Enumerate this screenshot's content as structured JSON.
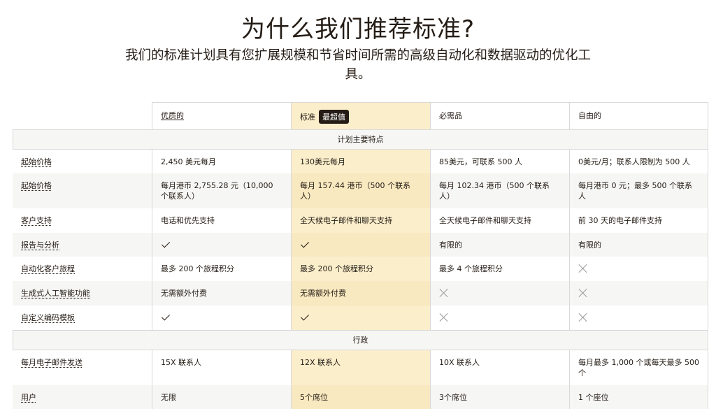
{
  "header": {
    "title": "为什么我们推荐标准?",
    "subtitle": "我们的标准计划具有您扩展规模和节省时间所需的高级自动化和数据驱动的优化工具。"
  },
  "plans": [
    {
      "name": "优质的",
      "badge": ""
    },
    {
      "name": "标准",
      "badge": "最超值"
    },
    {
      "name": "必需品",
      "badge": ""
    },
    {
      "name": "自由的",
      "badge": ""
    }
  ],
  "sections": {
    "features": "计划主要特点",
    "admin": "行政"
  },
  "rows": {
    "price_usd": {
      "label": "起始价格",
      "values": [
        "2,450 美元每月",
        "130美元每月",
        "85美元，可联系 500 人",
        "0美元/月；联系人限制为 500 人"
      ]
    },
    "price_hkd": {
      "label": "起始价格",
      "values": [
        "每月港币 2,755.28 元（10,000 个联系人）",
        "每月 157.44 港币（500 个联系人）",
        "每月 102.34 港币（500 个联系人）",
        "每月港币 0 元；最多 500 个联系人"
      ]
    },
    "support": {
      "label": "客户支持",
      "values": [
        "电话和优先支持",
        "全天候电子邮件和聊天支持",
        "全天候电子邮件和聊天支持",
        "前 30 天的电子邮件支持"
      ]
    },
    "reports": {
      "label": "报告与分析",
      "values": [
        "check",
        "check",
        "有限的",
        "有限的"
      ]
    },
    "journeys": {
      "label": "自动化客户旅程",
      "values": [
        "最多 200 个旅程积分",
        "最多 200 个旅程积分",
        "最多 4 个旅程积分",
        "cross"
      ]
    },
    "ai": {
      "label": "生成式人工智能功能",
      "values": [
        "无需额外付费",
        "无需额外付费",
        "cross",
        "cross"
      ]
    },
    "templates": {
      "label": "自定义编码模板",
      "values": [
        "check",
        "check",
        "cross",
        "cross"
      ]
    },
    "sends": {
      "label": "每月电子邮件发送",
      "values": [
        "15X 联系人",
        "12X 联系人",
        "10X 联系人",
        "每月最多 1,000 个或每天最多 500 个"
      ]
    },
    "users": {
      "label": "用户",
      "values": [
        "无限",
        "5个席位",
        "3个席位",
        "1 个座位"
      ]
    }
  },
  "icons": {
    "check": "checkmark-icon",
    "cross": "x-mark-icon"
  },
  "colors": {
    "highlight": "#fbeecb",
    "text": "#241c15",
    "badge_bg": "#241c15"
  }
}
